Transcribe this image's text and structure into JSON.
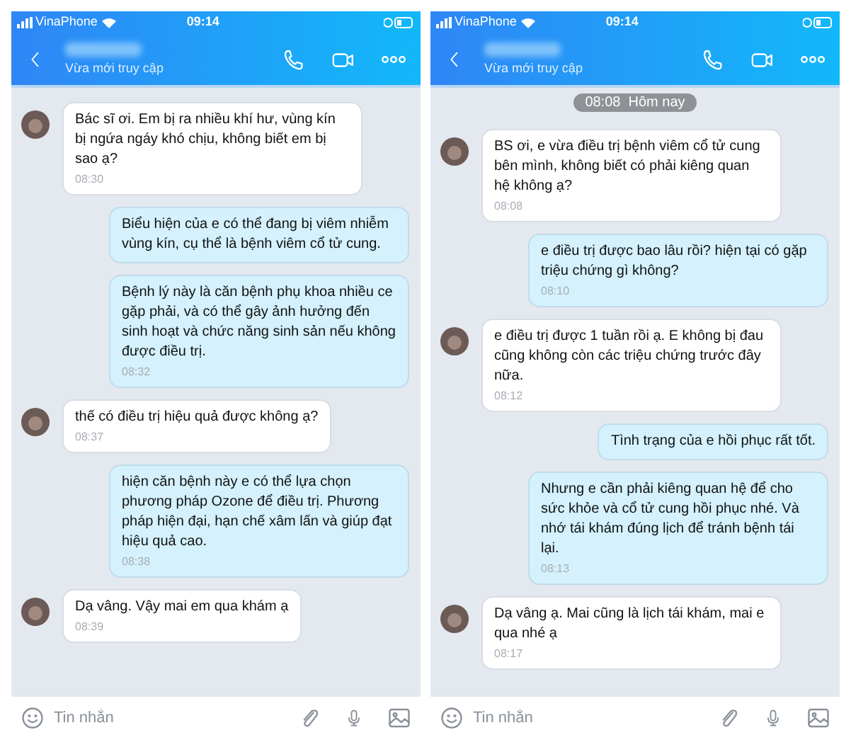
{
  "screens": [
    {
      "status_bar": {
        "carrier": "VinaPhone",
        "time": "09:14"
      },
      "header": {
        "subtitle": "Vừa mới truy cập"
      },
      "messages": [
        {
          "kind": "incoming",
          "text": "Bác sĩ ơi. Em bị ra nhiều khí hư, vùng kín bị ngứa ngáy khó chịu, không biết em bị sao ạ?",
          "time": "08:30"
        },
        {
          "kind": "outgoing",
          "text": "Biểu hiện của e có thể đang bị viêm nhiễm vùng kín, cụ thể là bệnh viêm cổ tử cung."
        },
        {
          "kind": "outgoing",
          "text": "Bệnh lý này là căn bệnh phụ khoa nhiều ce gặp phải, và có thể gây ảnh hưởng đến sinh hoạt và chức năng sinh sản nếu không được điều trị.",
          "time": "08:32"
        },
        {
          "kind": "incoming",
          "text": "thế có điều trị hiệu quả được không ạ?",
          "time": "08:37"
        },
        {
          "kind": "outgoing",
          "text": "hiện căn bệnh này e có thể lựa chọn phương pháp Ozone để điều trị. Phương pháp hiện đại, hạn chế xâm lấn và giúp đạt hiệu quả cao.",
          "time": "08:38"
        },
        {
          "kind": "incoming",
          "text": "Dạ vâng. Vậy mai em qua khám ạ",
          "time": "08:39"
        }
      ],
      "input": {
        "placeholder": "Tin nhắn"
      }
    },
    {
      "status_bar": {
        "carrier": "VinaPhone",
        "time": "09:14"
      },
      "header": {
        "subtitle": "Vừa mới truy cập"
      },
      "messages": [
        {
          "kind": "date",
          "text": "08:08  Hôm nay"
        },
        {
          "kind": "incoming",
          "text": "BS ơi, e vừa điều trị bệnh viêm cổ tử cung bên mình, không biết có phải kiêng quan hệ không ạ?",
          "time": "08:08"
        },
        {
          "kind": "outgoing",
          "text": "e điều trị được bao lâu rồi? hiện tại có gặp triệu chứng gì không?",
          "time": "08:10"
        },
        {
          "kind": "incoming",
          "text": "e điều trị được 1 tuần rồi ạ. E không bị đau cũng không còn các triệu chứng trước đây nữa.",
          "time": "08:12"
        },
        {
          "kind": "outgoing",
          "text": "Tình trạng của e hồi phục rất tốt."
        },
        {
          "kind": "outgoing",
          "text": "Nhưng e cần phải kiêng quan hệ để cho sức khỏe và cổ tử cung hồi phục nhé. Và nhớ tái khám đúng lịch để tránh bệnh tái lại.",
          "time": "08:13"
        },
        {
          "kind": "incoming",
          "text": "Dạ vâng ạ. Mai cũng là lịch tái khám, mai e qua nhé ạ",
          "time": "08:17"
        }
      ],
      "input": {
        "placeholder": "Tin nhắn"
      }
    }
  ]
}
